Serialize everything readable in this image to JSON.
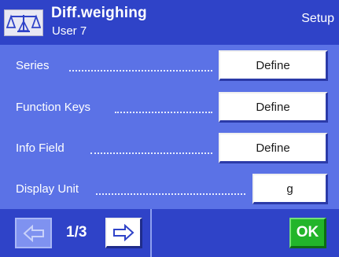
{
  "header": {
    "title": "Diff.weighing",
    "subtitle": "User 7",
    "mode": "Setup",
    "icon": "balance-scale-icon"
  },
  "rows": [
    {
      "label": "Series",
      "button": "Define"
    },
    {
      "label": "Function Keys",
      "button": "Define"
    },
    {
      "label": "Info Field",
      "button": "Define"
    },
    {
      "label": "Display Unit",
      "button": "g"
    }
  ],
  "footer": {
    "page": "1/3",
    "prev_icon": "arrow-left-icon",
    "next_icon": "arrow-right-icon",
    "ok_label": "OK",
    "ok_color": "#22b52a"
  },
  "colors": {
    "header_bg": "#2f43c8",
    "content_bg": "#5b72e6"
  }
}
